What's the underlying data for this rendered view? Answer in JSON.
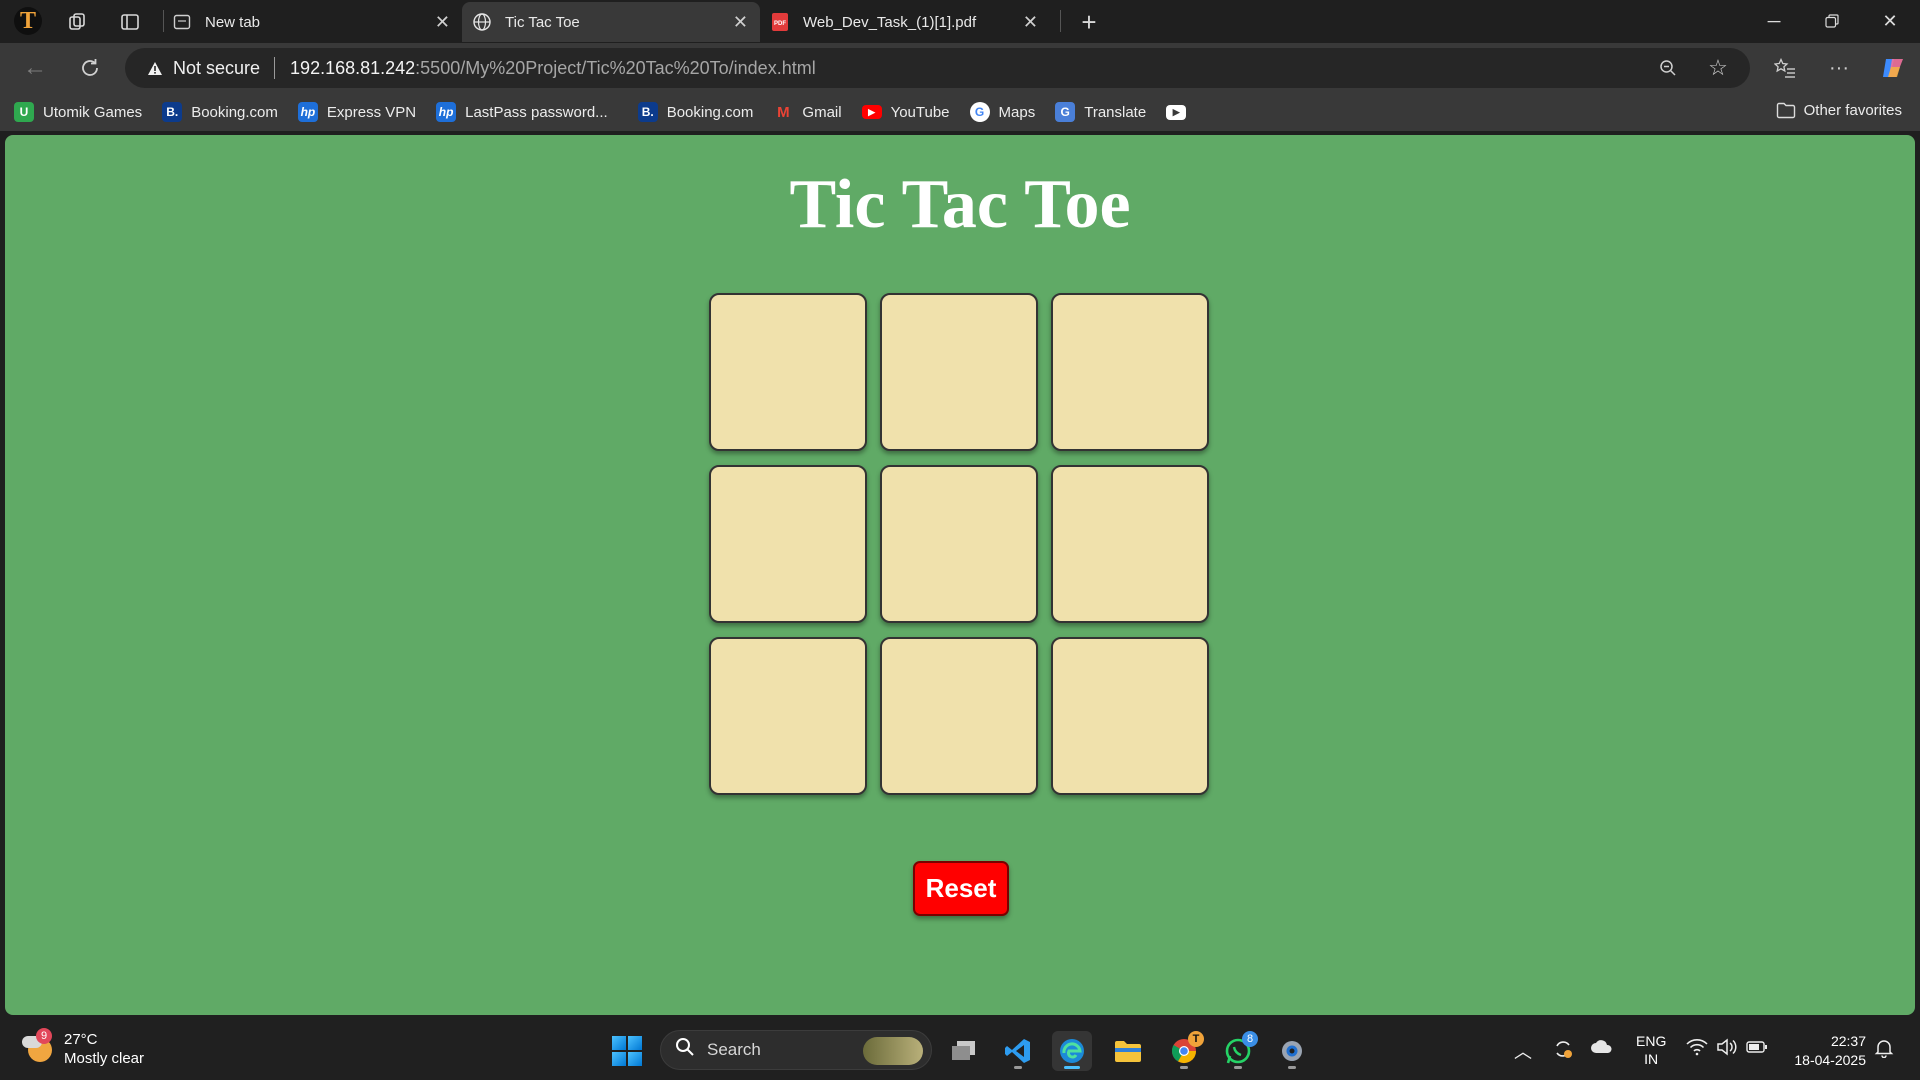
{
  "browser": {
    "profile_initial": "T",
    "tabs": [
      {
        "title": "New tab",
        "icon": "new-tab-icon"
      },
      {
        "title": "Tic Tac Toe",
        "icon": "globe-icon"
      },
      {
        "title": "Web_Dev_Task_(1)[1].pdf",
        "icon": "pdf-icon"
      }
    ],
    "address": {
      "security_label": "Not secure",
      "url_host": "192.168.81.242",
      "url_rest": ":5500/My%20Project/Tic%20Tac%20To/index.html"
    },
    "favorites": [
      {
        "label": "Utomik Games",
        "icon": "U",
        "color": "#2fa84f"
      },
      {
        "label": "Booking.com",
        "icon": "B.",
        "color": "#0c3b8c"
      },
      {
        "label": "Express VPN",
        "icon": "hp",
        "color": "#1e6fd9"
      },
      {
        "label": "LastPass password...",
        "icon": "hp",
        "color": "#1e6fd9"
      },
      {
        "label": "Booking.com",
        "icon": "B.",
        "color": "#0c3b8c"
      },
      {
        "label": "Gmail",
        "icon": "M",
        "color": "#ea4335"
      },
      {
        "label": "YouTube",
        "icon": "▶",
        "color": "#ff0000"
      },
      {
        "label": "Maps",
        "icon": "G",
        "color": "#4285f4"
      },
      {
        "label": "Translate",
        "icon": "G",
        "color": "#4a7fd8"
      }
    ],
    "other_favorites": "Other favorites"
  },
  "page": {
    "title": "Tic Tac Toe",
    "cells": [
      "",
      "",
      "",
      "",
      "",
      "",
      "",
      "",
      ""
    ],
    "reset_label": "Reset",
    "colors": {
      "background": "#60aa66",
      "cell": "#f0e1ac",
      "reset": "#ff0000"
    }
  },
  "taskbar": {
    "weather": {
      "temp": "27°C",
      "condition": "Mostly clear",
      "badge": "9"
    },
    "search_label": "Search",
    "whatsapp_badge": "8",
    "lang_line1": "ENG",
    "lang_line2": "IN",
    "time": "22:37",
    "date": "18-04-2025"
  }
}
